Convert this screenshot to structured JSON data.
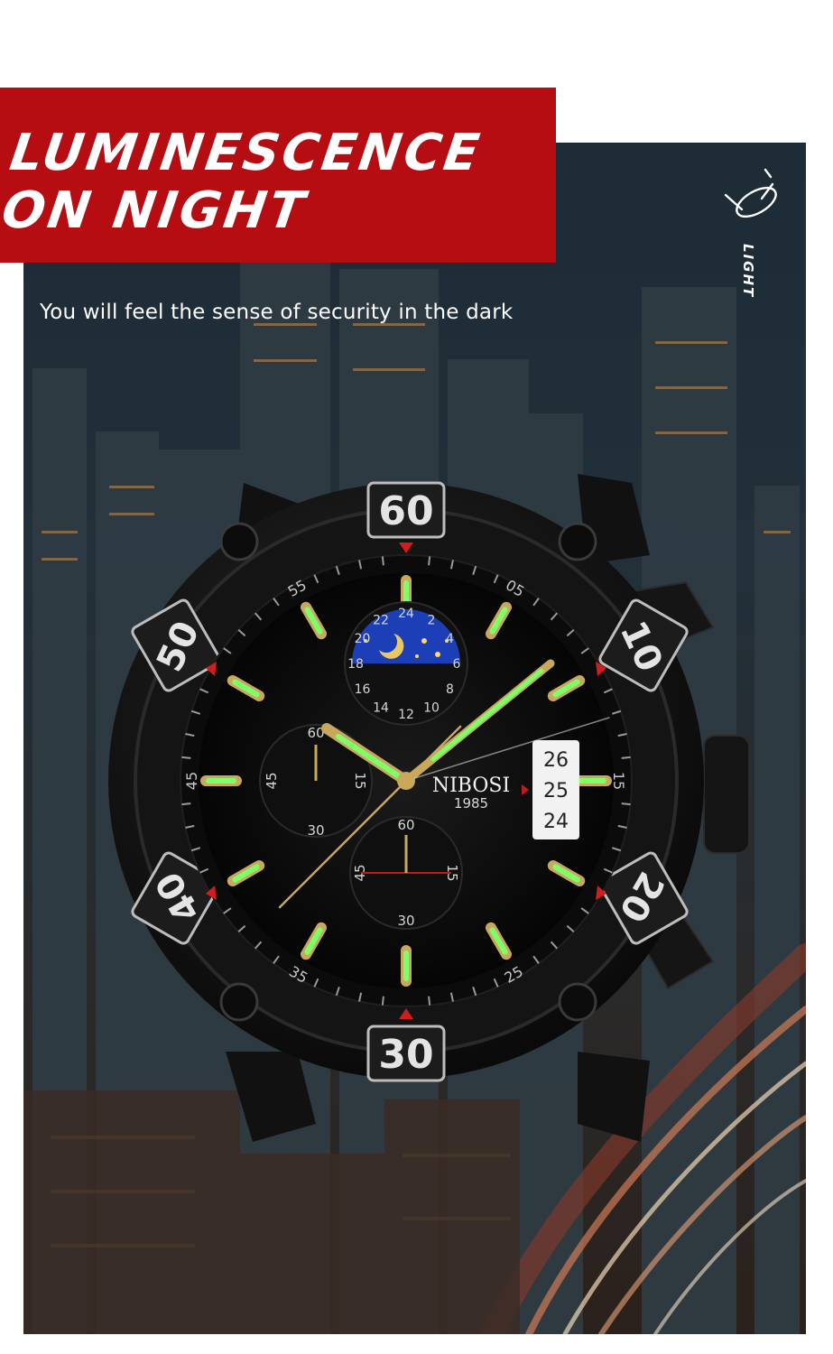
{
  "headline": {
    "line1": "LUMINESCENCE",
    "line2": "ON NIGHT"
  },
  "tagline": "You will feel the sense of security in the dark",
  "light_label": "LIGHT",
  "watch": {
    "brand": "NIBOSI",
    "year": "1985",
    "bezel_numbers": [
      "60",
      "10",
      "20",
      "30",
      "40",
      "50"
    ],
    "minute_track": [
      "05",
      "15",
      "25",
      "35",
      "45",
      "55"
    ],
    "date_window": [
      "26",
      "25",
      "24"
    ],
    "subdial_left": [
      "60",
      "15",
      "30",
      "45"
    ],
    "subdial_bottom": [
      "60",
      "15",
      "30",
      "45"
    ],
    "subdial_top": [
      "24",
      "2",
      "4",
      "6",
      "8",
      "10",
      "12",
      "14",
      "16",
      "18",
      "20",
      "22"
    ]
  },
  "colors": {
    "banner": "#b50d12",
    "lume": "#7dff6a",
    "gold": "#c9a85c",
    "moon_dial": "#1c3fb8"
  }
}
